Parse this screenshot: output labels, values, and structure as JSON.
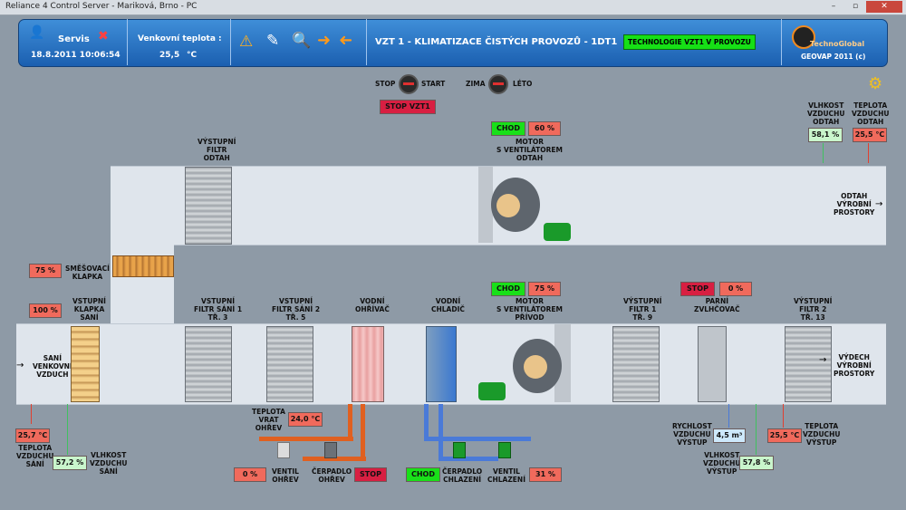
{
  "window_title": "Reliance 4 Control Server - Mariková, Brno - PC",
  "header": {
    "user_name": "Servis",
    "datetime": "18.8.2011 10:06:54",
    "outdoor_temp_label": "Venkovní teplota :",
    "outdoor_temp_value": "25,5",
    "outdoor_temp_unit": "°C",
    "title": "VZT 1 - KLIMATIZACE ČISTÝCH PROVOZŮ - 1DT1",
    "status_badge": "TECHNOLOGIE VZT1 V PROVOZU",
    "copyright": "GEOVAP 2011 (c)",
    "logo_text": "TechnoGlobal"
  },
  "controls": {
    "stop_label": "STOP",
    "start_label": "START",
    "zima_label": "ZIMA",
    "leto_label": "LÉTO",
    "stop_vzt_button": "STOP VZT1"
  },
  "upper_duct": {
    "filter_label": "VÝSTUPNÍ\nFILTR\nODTAH",
    "motor_label": "MOTOR\nS VENTILÁTOREM\nODTAH",
    "motor_status": "CHOD",
    "motor_value": "60 %",
    "exhaust_label": "ODTAH\nVÝROBNÍ\nPROSTORY",
    "humidity_label": "VLHKOST\nVZDUCHU\nODTAH",
    "humidity_value": "58,1 %",
    "temp_label": "TEPLOTA\nVZDUCHU\nODTAH",
    "temp_value": "25,5 °C"
  },
  "mixing": {
    "value": "75 %",
    "label": "SMĚŠOVACÍ\nKLAPKA"
  },
  "lower_duct": {
    "intake_label": "SANÍ\nVENKOVNÍ\nVZDUCH",
    "damper_value": "100 %",
    "damper_label": "VSTUPNÍ\nKLAPKA\nSANÍ",
    "filter1_label": "VSTUPNÍ\nFILTR SÁNÍ 1\nTŘ. 3",
    "filter2_label": "VSTUPNÍ\nFILTR SÁNÍ 2\nTŘ. 5",
    "heater_label": "VODNÍ\nOHŘÍVAČ",
    "cooler_label": "VODNÍ\nCHLADIČ",
    "motor_label": "MOTOR\nS VENTILÁTOREM\nPŘÍVOD",
    "motor_status": "CHOD",
    "motor_value": "75 %",
    "filter3_label": "VÝSTUPNÍ\nFILTR 1\nTŘ. 9",
    "humidifier_label": "PARNÍ\nZVLHČOVAČ",
    "humidifier_status": "STOP",
    "humidifier_value": "0 %",
    "filter4_label": "VÝSTUPNÍ\nFILTR 2\nTŘ. 13",
    "outlet_label": "VÝDECH\nVÝROBNÍ\nPROSTORY"
  },
  "bottom": {
    "intake_temp_value": "25,7 °C",
    "intake_temp_label": "TEPLOTA\nVZDUCHU\nSÁNÍ",
    "intake_hum_value": "57,2 %",
    "intake_hum_label": "VLHKOST\nVZDUCHU\nSÁNÍ",
    "return_temp_label": "TEPLOTA\nVRAT\nOHŘEV",
    "return_temp_value": "24,0 °C",
    "heat_valve_value": "0 %",
    "heat_valve_label": "VENTIL\nOHŘEV",
    "heat_pump_label": "ČERPADLO\nOHŘEV",
    "heat_pump_status": "STOP",
    "cool_status": "CHOD",
    "cool_pump_label": "ČERPADLO\nCHLAZENÍ",
    "cool_valve_label": "VENTIL\nCHLAZENÍ",
    "cool_valve_value": "31 %",
    "speed_label": "RYCHLOST\nVZDUCHU\nVÝSTUP",
    "speed_value": "4,5 m³",
    "out_hum_label": "VLHKOST\nVZDUCHU\nVÝSTUP",
    "out_hum_value": "57,8 %",
    "out_temp_value": "25,5 °C",
    "out_temp_label": "TEPLOTA\nVZDUCHU\nVÝSTUP"
  }
}
